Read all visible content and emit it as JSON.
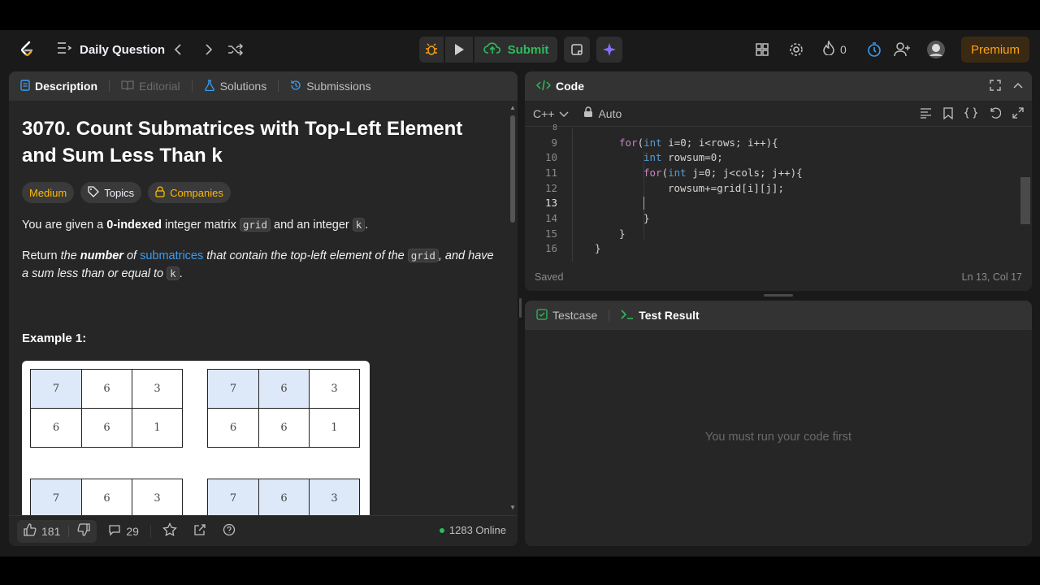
{
  "topbar": {
    "list_label": "Daily Question",
    "submit_label": "Submit",
    "streak_count": "0",
    "premium_label": "Premium"
  },
  "left_tabs": {
    "description": "Description",
    "editorial": "Editorial",
    "solutions": "Solutions",
    "submissions": "Submissions"
  },
  "problem": {
    "title_line1": "3070. Count Submatrices with Top-Left Element",
    "title_line2": "and Sum Less Than k",
    "difficulty": "Medium",
    "topics": "Topics",
    "companies": "Companies",
    "p1_a": "You are given a ",
    "p1_b": "0-indexed",
    "p1_c": " integer matrix ",
    "p1_code1": "grid",
    "p1_d": " and an integer ",
    "p1_code2": "k",
    "p1_e": ".",
    "p2_a": "Return ",
    "p2_b": "the ",
    "p2_c": "number",
    "p2_d": " of ",
    "p2_link": "submatrices",
    "p2_e": " that contain the top-left element of the ",
    "p2_code": "grid",
    "p2_f": ", and have",
    "p2_g": "a sum less than or equal to ",
    "p2_code2": "k",
    "p2_h": ".",
    "example_label": "Example 1:"
  },
  "example_grids": [
    [
      "7",
      "6",
      "3",
      "6",
      "6",
      "1"
    ],
    [
      "7",
      "6",
      "3",
      "6",
      "6",
      "1"
    ],
    [
      "7",
      "6",
      "3"
    ],
    [
      "7",
      "6",
      "3"
    ]
  ],
  "footer": {
    "likes": "181",
    "comments": "29",
    "online": "1283 Online"
  },
  "code_panel": {
    "title": "Code",
    "language": "C++",
    "mode": "Auto",
    "saved": "Saved",
    "position": "Ln 13, Col 17"
  },
  "code_lines": [
    {
      "n": "8",
      "text": ""
    },
    {
      "n": "9",
      "text": "for(int i=0; i<rows; i++){"
    },
    {
      "n": "10",
      "text": "int rowsum=0;"
    },
    {
      "n": "11",
      "text": "for(int j=0; j<cols; j++){"
    },
    {
      "n": "12",
      "text": "rowsum+=grid[i][j];"
    },
    {
      "n": "13",
      "text": ""
    },
    {
      "n": "14",
      "text": "}"
    },
    {
      "n": "15",
      "text": "}"
    },
    {
      "n": "16",
      "text": "}"
    }
  ],
  "result_panel": {
    "testcase_tab": "Testcase",
    "result_tab": "Test Result",
    "empty_message": "You must run your code first"
  },
  "colors": {
    "accent_green": "#2cbb5d",
    "premium": "#ffa116",
    "medium": "#ffb800",
    "link": "#3d9cf0"
  }
}
